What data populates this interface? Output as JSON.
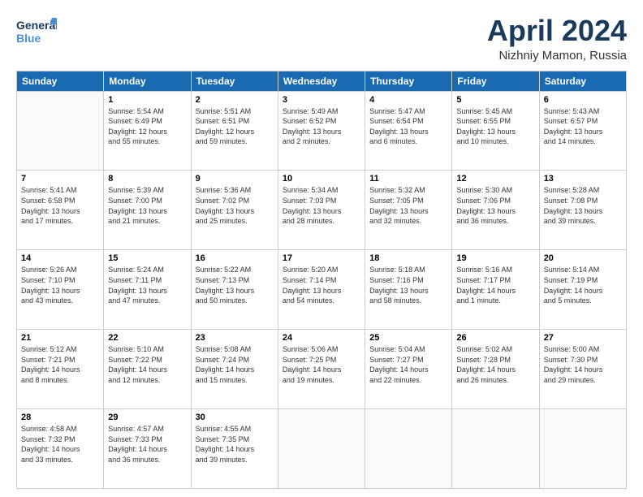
{
  "header": {
    "logo_general": "General",
    "logo_blue": "Blue",
    "title": "April 2024",
    "subtitle": "Nizhniy Mamon, Russia"
  },
  "columns": [
    "Sunday",
    "Monday",
    "Tuesday",
    "Wednesday",
    "Thursday",
    "Friday",
    "Saturday"
  ],
  "weeks": [
    [
      {
        "day": "",
        "info": ""
      },
      {
        "day": "1",
        "info": "Sunrise: 5:54 AM\nSunset: 6:49 PM\nDaylight: 12 hours\nand 55 minutes."
      },
      {
        "day": "2",
        "info": "Sunrise: 5:51 AM\nSunset: 6:51 PM\nDaylight: 12 hours\nand 59 minutes."
      },
      {
        "day": "3",
        "info": "Sunrise: 5:49 AM\nSunset: 6:52 PM\nDaylight: 13 hours\nand 2 minutes."
      },
      {
        "day": "4",
        "info": "Sunrise: 5:47 AM\nSunset: 6:54 PM\nDaylight: 13 hours\nand 6 minutes."
      },
      {
        "day": "5",
        "info": "Sunrise: 5:45 AM\nSunset: 6:55 PM\nDaylight: 13 hours\nand 10 minutes."
      },
      {
        "day": "6",
        "info": "Sunrise: 5:43 AM\nSunset: 6:57 PM\nDaylight: 13 hours\nand 14 minutes."
      }
    ],
    [
      {
        "day": "7",
        "info": "Sunrise: 5:41 AM\nSunset: 6:58 PM\nDaylight: 13 hours\nand 17 minutes."
      },
      {
        "day": "8",
        "info": "Sunrise: 5:39 AM\nSunset: 7:00 PM\nDaylight: 13 hours\nand 21 minutes."
      },
      {
        "day": "9",
        "info": "Sunrise: 5:36 AM\nSunset: 7:02 PM\nDaylight: 13 hours\nand 25 minutes."
      },
      {
        "day": "10",
        "info": "Sunrise: 5:34 AM\nSunset: 7:03 PM\nDaylight: 13 hours\nand 28 minutes."
      },
      {
        "day": "11",
        "info": "Sunrise: 5:32 AM\nSunset: 7:05 PM\nDaylight: 13 hours\nand 32 minutes."
      },
      {
        "day": "12",
        "info": "Sunrise: 5:30 AM\nSunset: 7:06 PM\nDaylight: 13 hours\nand 36 minutes."
      },
      {
        "day": "13",
        "info": "Sunrise: 5:28 AM\nSunset: 7:08 PM\nDaylight: 13 hours\nand 39 minutes."
      }
    ],
    [
      {
        "day": "14",
        "info": "Sunrise: 5:26 AM\nSunset: 7:10 PM\nDaylight: 13 hours\nand 43 minutes."
      },
      {
        "day": "15",
        "info": "Sunrise: 5:24 AM\nSunset: 7:11 PM\nDaylight: 13 hours\nand 47 minutes."
      },
      {
        "day": "16",
        "info": "Sunrise: 5:22 AM\nSunset: 7:13 PM\nDaylight: 13 hours\nand 50 minutes."
      },
      {
        "day": "17",
        "info": "Sunrise: 5:20 AM\nSunset: 7:14 PM\nDaylight: 13 hours\nand 54 minutes."
      },
      {
        "day": "18",
        "info": "Sunrise: 5:18 AM\nSunset: 7:16 PM\nDaylight: 13 hours\nand 58 minutes."
      },
      {
        "day": "19",
        "info": "Sunrise: 5:16 AM\nSunset: 7:17 PM\nDaylight: 14 hours\nand 1 minute."
      },
      {
        "day": "20",
        "info": "Sunrise: 5:14 AM\nSunset: 7:19 PM\nDaylight: 14 hours\nand 5 minutes."
      }
    ],
    [
      {
        "day": "21",
        "info": "Sunrise: 5:12 AM\nSunset: 7:21 PM\nDaylight: 14 hours\nand 8 minutes."
      },
      {
        "day": "22",
        "info": "Sunrise: 5:10 AM\nSunset: 7:22 PM\nDaylight: 14 hours\nand 12 minutes."
      },
      {
        "day": "23",
        "info": "Sunrise: 5:08 AM\nSunset: 7:24 PM\nDaylight: 14 hours\nand 15 minutes."
      },
      {
        "day": "24",
        "info": "Sunrise: 5:06 AM\nSunset: 7:25 PM\nDaylight: 14 hours\nand 19 minutes."
      },
      {
        "day": "25",
        "info": "Sunrise: 5:04 AM\nSunset: 7:27 PM\nDaylight: 14 hours\nand 22 minutes."
      },
      {
        "day": "26",
        "info": "Sunrise: 5:02 AM\nSunset: 7:28 PM\nDaylight: 14 hours\nand 26 minutes."
      },
      {
        "day": "27",
        "info": "Sunrise: 5:00 AM\nSunset: 7:30 PM\nDaylight: 14 hours\nand 29 minutes."
      }
    ],
    [
      {
        "day": "28",
        "info": "Sunrise: 4:58 AM\nSunset: 7:32 PM\nDaylight: 14 hours\nand 33 minutes."
      },
      {
        "day": "29",
        "info": "Sunrise: 4:57 AM\nSunset: 7:33 PM\nDaylight: 14 hours\nand 36 minutes."
      },
      {
        "day": "30",
        "info": "Sunrise: 4:55 AM\nSunset: 7:35 PM\nDaylight: 14 hours\nand 39 minutes."
      },
      {
        "day": "",
        "info": ""
      },
      {
        "day": "",
        "info": ""
      },
      {
        "day": "",
        "info": ""
      },
      {
        "day": "",
        "info": ""
      }
    ]
  ]
}
